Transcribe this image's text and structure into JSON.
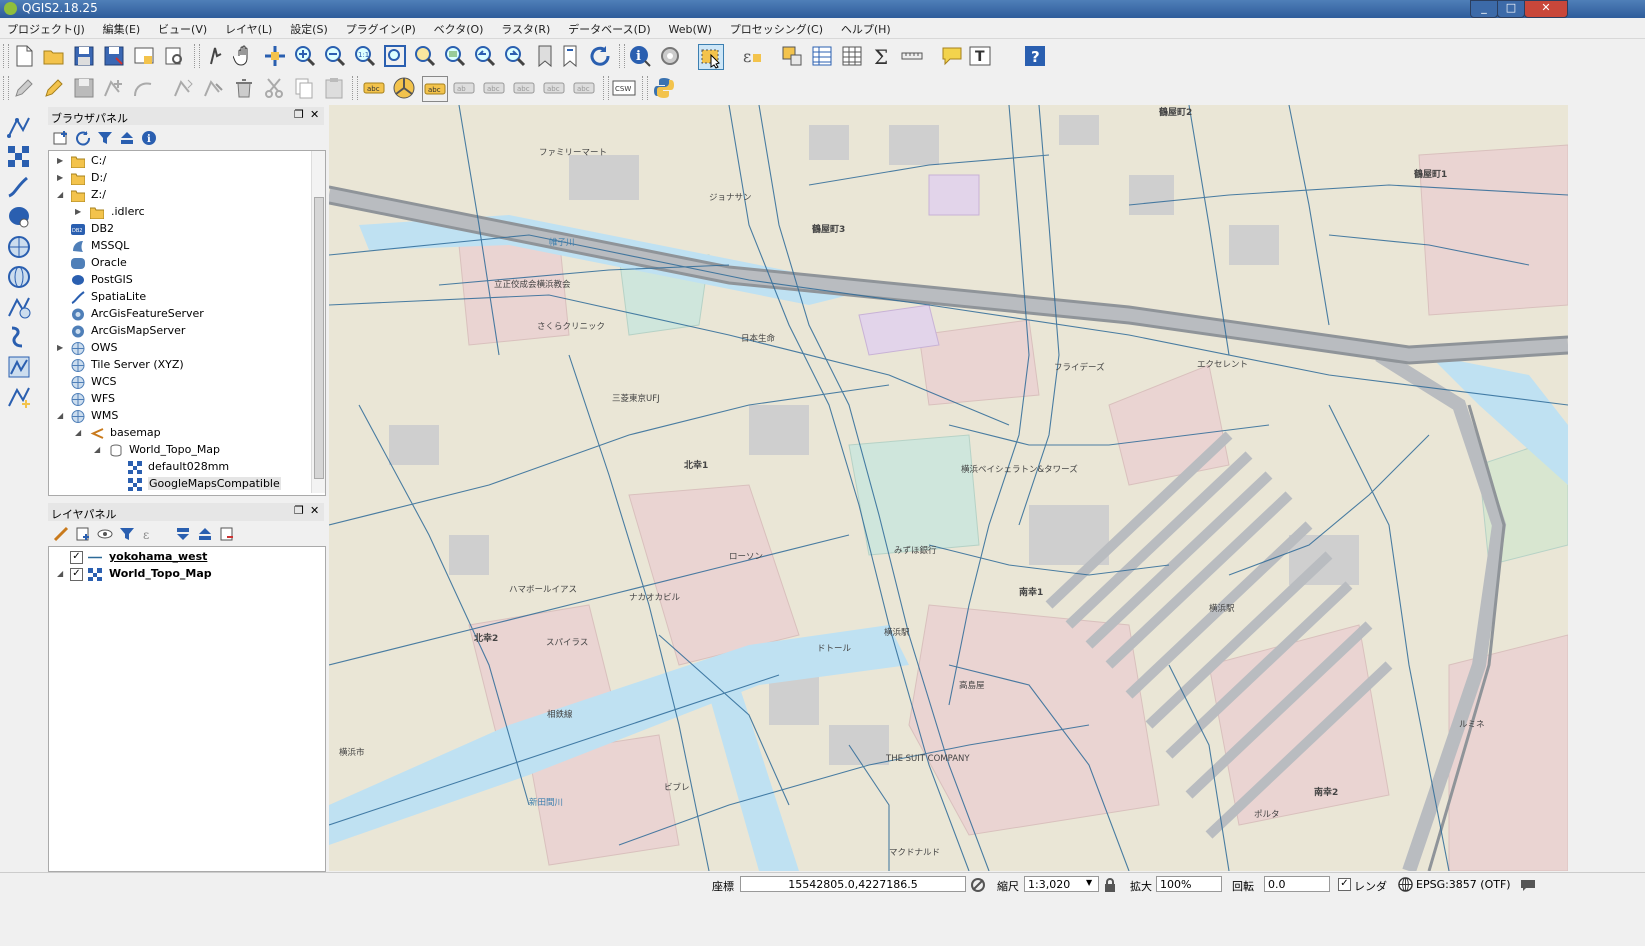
{
  "window": {
    "title": "QGIS2.18.25"
  },
  "menu": [
    "プロジェクト(J)",
    "編集(E)",
    "ビュー(V)",
    "レイヤ(L)",
    "設定(S)",
    "プラグイン(P)",
    "ベクタ(O)",
    "ラスタ(R)",
    "データベース(D)",
    "Web(W)",
    "プロセッシング(C)",
    "ヘルプ(H)"
  ],
  "browser_panel": {
    "title": "ブラウザパネル",
    "items": [
      {
        "label": "C:/",
        "icon": "folder-icon"
      },
      {
        "label": "D:/",
        "icon": "folder-icon"
      },
      {
        "label": "Z:/",
        "icon": "folder-icon"
      },
      {
        "label": ".idlerc",
        "icon": "folder-icon"
      },
      {
        "label": "DB2",
        "icon": "db2-icon"
      },
      {
        "label": "MSSQL",
        "icon": "mssql-icon"
      },
      {
        "label": "Oracle",
        "icon": "oracle-icon"
      },
      {
        "label": "PostGIS",
        "icon": "postgis-icon"
      },
      {
        "label": "SpatiaLite",
        "icon": "spatialite-icon"
      },
      {
        "label": "ArcGisFeatureServer",
        "icon": "arcgis-icon"
      },
      {
        "label": "ArcGisMapServer",
        "icon": "arcgis-icon"
      },
      {
        "label": "OWS",
        "icon": "globe-icon"
      },
      {
        "label": "Tile Server (XYZ)",
        "icon": "globe-icon"
      },
      {
        "label": "WCS",
        "icon": "globe-icon"
      },
      {
        "label": "WFS",
        "icon": "globe-icon"
      },
      {
        "label": "WMS",
        "icon": "globe-icon"
      },
      {
        "label": "basemap",
        "icon": "connection-icon"
      },
      {
        "label": "World_Topo_Map",
        "icon": "database-icon"
      },
      {
        "label": "default028mm",
        "icon": "raster-icon"
      },
      {
        "label": "GoogleMapsCompatible",
        "icon": "raster-icon"
      }
    ]
  },
  "layer_panel": {
    "title": "レイヤパネル",
    "layers": [
      {
        "label": "yokohama_west",
        "checked": "✓"
      },
      {
        "label": "World_Topo_Map",
        "checked": "✓"
      }
    ]
  },
  "map": {
    "labels": {
      "l1": "北幸1",
      "l2": "北幸2",
      "l3": "南幸1",
      "l4": "南幸2",
      "l5": "鶴屋町1",
      "l6": "鶴屋町2",
      "l7": "鶴屋町3",
      "l8": "横浜駅",
      "l9": "高島屋",
      "l10": "立正佼成会横浜教会",
      "l11": "さくらクリニック",
      "l12": "日本生命",
      "l13": "三菱東京UFJ",
      "l14": "横浜ベイシェラトン&タワーズ",
      "l15": "ドトール",
      "l16": "相鉄線",
      "l17": "ジョナサン",
      "l18": "ファミリーマート",
      "l19": "ローソン",
      "l20": "みずほ銀行",
      "l21": "スパイラス",
      "l22": "ハマボールイアス",
      "l23": "ナカオカビル",
      "l24": "横浜駅",
      "l25": "THE SUIT COMPANY",
      "l26": "マクドナルド",
      "l27": "ビブレ",
      "l28": "ルミネ",
      "l29": "ポルタ",
      "l30": "フライデーズ",
      "l31": "エクセレント",
      "l32": "横浜市",
      "l33": "新田間川",
      "l34": "帷子川"
    }
  },
  "status": {
    "coord_label": "座標",
    "coord_value": "15542805.0,4227186.5",
    "scale_label": "縮尺",
    "scale_value": "1:3,020",
    "zoom_label": "拡大",
    "zoom_value": "100%",
    "rotation_label": "回転",
    "rotation_value": "0.0",
    "render_label": "レンダ",
    "crs_label": "EPSG:3857 (OTF)"
  },
  "colors": {
    "title_bar": "#2e5c9a",
    "road_line": "#2d6a98",
    "water": "#bfe1f2",
    "land": "#eae6d6"
  }
}
